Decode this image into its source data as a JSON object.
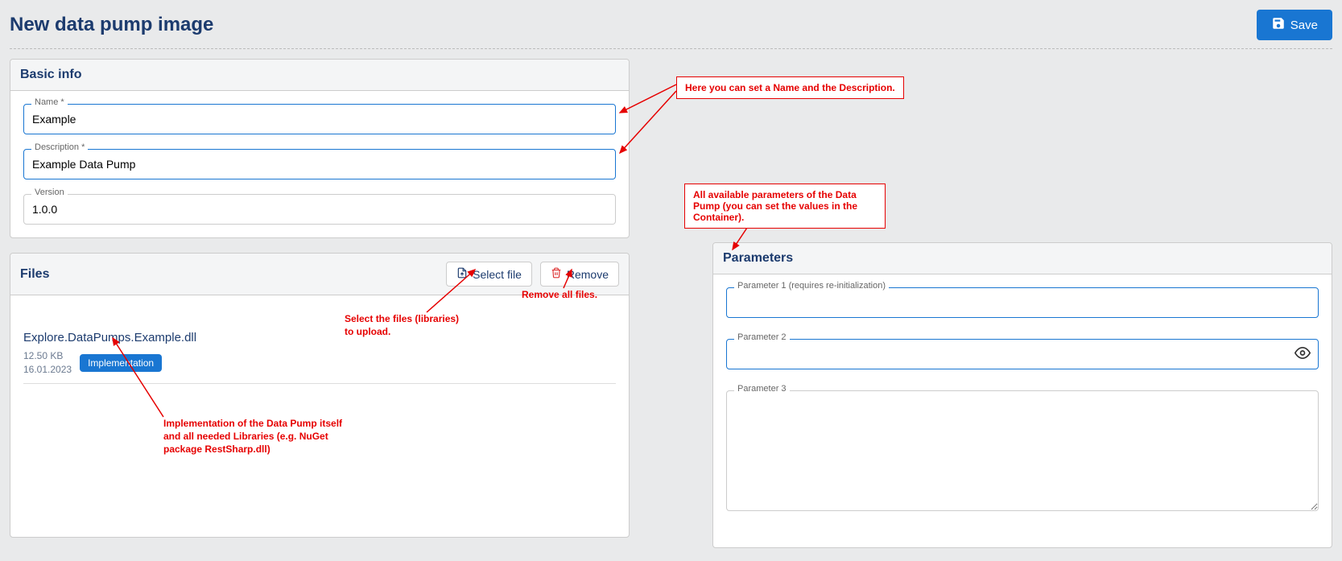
{
  "header": {
    "title": "New data pump image",
    "save_label": "Save"
  },
  "basic_info": {
    "card_title": "Basic info",
    "name_label": "Name *",
    "name_value": "Example",
    "description_label": "Description *",
    "description_value": "Example Data Pump",
    "version_label": "Version",
    "version_value": "1.0.0"
  },
  "files": {
    "card_title": "Files",
    "select_label": "Select file",
    "remove_label": "Remove",
    "items": [
      {
        "name": "Explore.DataPumps.Example.dll",
        "size": "12.50 KB",
        "date": "16.01.2023",
        "chip": "Implementation"
      }
    ]
  },
  "parameters": {
    "card_title": "Parameters",
    "p1_label": "Parameter 1 (requires re-initialization)",
    "p2_label": "Parameter 2",
    "p3_label": "Parameter 3"
  },
  "annotations": {
    "name_desc": "Here you can set a Name and the Description.",
    "params": "All available parameters of the Data Pump (you can set the values in the Container).",
    "remove_all": "Remove all files.",
    "select_files": "Select the files (libraries) to upload.",
    "impl": "Implementation of the Data Pump itself and all needed Libraries (e.g. NuGet package RestSharp.dll)"
  }
}
